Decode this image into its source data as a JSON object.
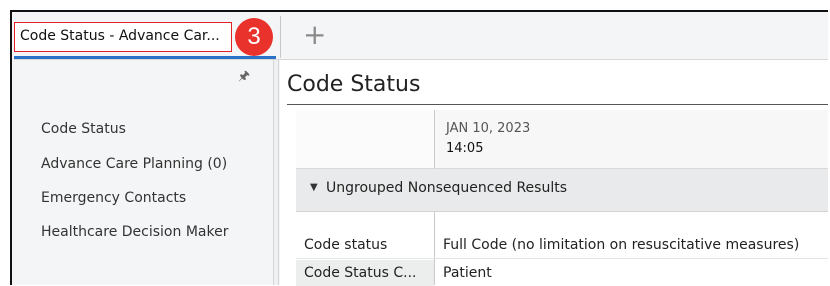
{
  "tabs": [
    {
      "label": "Code Status - Advance Car..."
    }
  ],
  "badge": {
    "number": "3",
    "color": "#e8322b"
  },
  "add_tab_icon": "plus-icon",
  "sidebar": {
    "pin_icon": "pin-icon",
    "items": [
      {
        "label": "Code Status"
      },
      {
        "label": "Advance Care Planning (0)"
      },
      {
        "label": "Emergency Contacts"
      },
      {
        "label": "Healthcare Decision Maker"
      }
    ]
  },
  "main": {
    "title": "Code Status",
    "date_column": {
      "date": "JAN 10, 2023",
      "time": "14:05"
    },
    "group": {
      "label": "Ungrouped Nonsequenced Results",
      "icon": "caret-down-icon"
    },
    "rows": [
      {
        "label": "Code status",
        "value": "Full Code (no limitation on resuscitative measures)"
      },
      {
        "label": "Code Status C...",
        "value": "Patient"
      }
    ]
  },
  "colors": {
    "highlight": "#e2222a",
    "accent": "#2a71c8"
  }
}
